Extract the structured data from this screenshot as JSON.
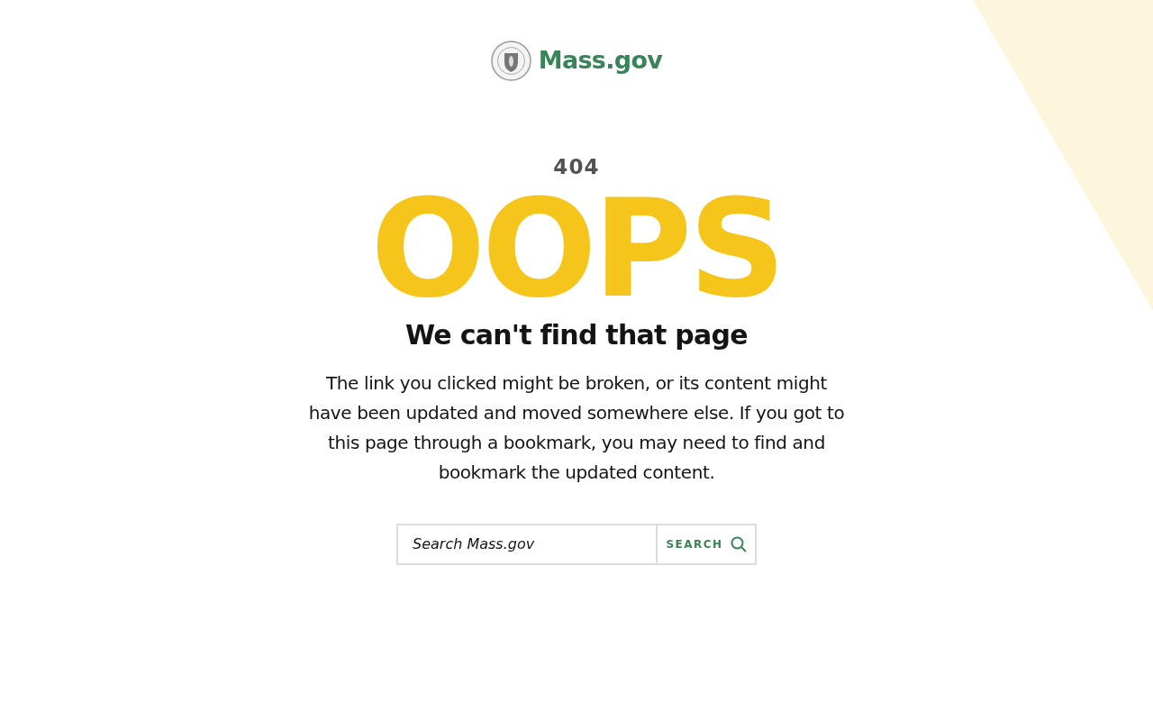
{
  "logo": {
    "text": "Mass.gov"
  },
  "error_code": "404",
  "headline": "OOPS",
  "title": "We can't find that page",
  "message": "The link you clicked might be broken, or its content might have been updated and moved somewhere else. If you got to this page through a bookmark, you may need to find and bookmark the updated content.",
  "search": {
    "placeholder": "Search Mass.gov",
    "button": "SEARCH"
  }
}
